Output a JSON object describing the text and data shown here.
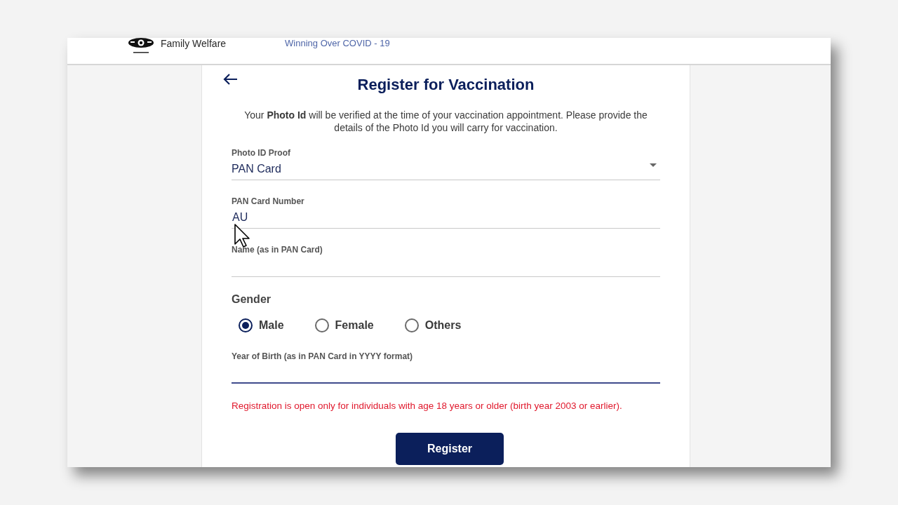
{
  "header": {
    "department": "Family Welfare",
    "tagline": "Winning Over COVID - 19"
  },
  "form": {
    "title": "Register for Vaccination",
    "intro": "Your **Photo Id** will be verified at the time of your vaccination appointment. Please provide the details of the Photo Id you will carry for vaccination.",
    "fields": [
      {
        "kind": "select",
        "label": "Photo ID Proof",
        "value": "PAN Card"
      },
      {
        "kind": "text",
        "label": "PAN Card Number",
        "value": "AU",
        "focused": false
      },
      {
        "kind": "text",
        "label": "Name (as in PAN Card)",
        "focused": false
      },
      {
        "kind": "radio",
        "label": "Gender",
        "options": [
          {
            "label": "Male",
            "selected": true
          },
          {
            "label": "Female",
            "selected": false
          },
          {
            "label": "Others",
            "selected": false
          }
        ]
      },
      {
        "kind": "text",
        "label": "Year of Birth (as in PAN Card in YYYY format)",
        "focused": true
      }
    ],
    "notice": "Registration is open only for individuals with age 18 years or older (birth year 2003 or earlier).",
    "submit": "Register"
  }
}
